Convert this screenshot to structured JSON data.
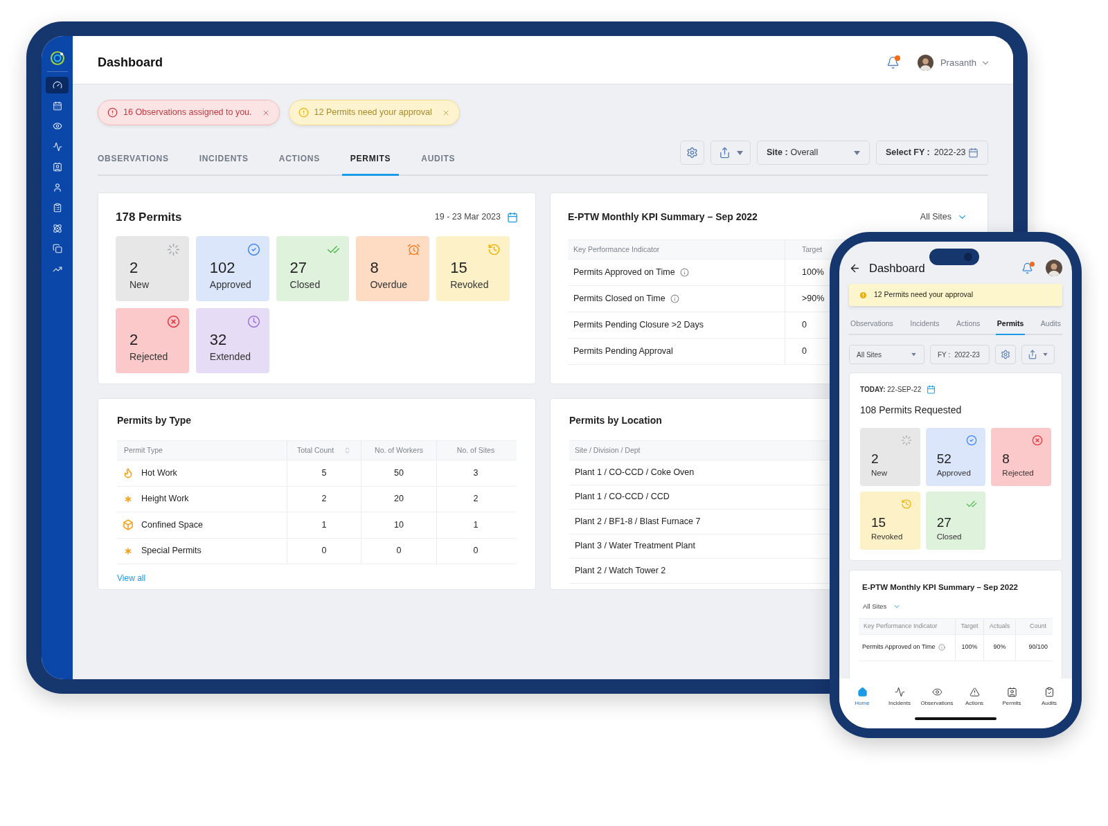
{
  "sidebar": {
    "items": [
      {
        "kind": "gauge",
        "selected": true
      },
      {
        "kind": "calendar",
        "selected": false
      },
      {
        "kind": "eye",
        "selected": false
      },
      {
        "kind": "activity",
        "selected": false
      },
      {
        "kind": "card",
        "selected": false
      },
      {
        "kind": "user",
        "selected": false
      },
      {
        "kind": "clipboard",
        "selected": false
      },
      {
        "kind": "atom",
        "selected": false
      },
      {
        "kind": "copy",
        "selected": false
      },
      {
        "kind": "trend",
        "selected": false
      }
    ]
  },
  "header": {
    "title": "Dashboard",
    "user": "Prasanth",
    "has_unread": true
  },
  "alerts": [
    {
      "kind": "error",
      "text": "16 Observations assigned to you."
    },
    {
      "kind": "warning",
      "text": "12 Permits need your approval"
    }
  ],
  "tabs": [
    {
      "label": "OBSERVATIONS",
      "selected": false
    },
    {
      "label": "INCIDENTS",
      "selected": false
    },
    {
      "label": "ACTIONS",
      "selected": false
    },
    {
      "label": "PERMITS",
      "selected": true
    },
    {
      "label": "AUDITS",
      "selected": false
    }
  ],
  "toolbar": {
    "site": {
      "label": "Site :",
      "value": "Overall"
    },
    "fy": {
      "label": "Select FY :",
      "value": "2022-23"
    }
  },
  "summary": {
    "title": "178 Permits",
    "date_range": "19 - 23 Mar 2023",
    "tiles": [
      {
        "kind": "new",
        "count": "2",
        "label": "New"
      },
      {
        "kind": "approved",
        "count": "102",
        "label": "Approved"
      },
      {
        "kind": "closed",
        "count": "27",
        "label": "Closed"
      },
      {
        "kind": "overdue",
        "count": "8",
        "label": "Overdue"
      },
      {
        "kind": "revoked",
        "count": "15",
        "label": "Revoked"
      },
      {
        "kind": "rejected",
        "count": "2",
        "label": "Rejected"
      },
      {
        "kind": "extended",
        "count": "32",
        "label": "Extended"
      }
    ]
  },
  "kpi": {
    "title": "E-PTW Monthly KPI Summary – Sep 2022",
    "filter": "All Sites",
    "columns": [
      "Key Performance Indicator",
      "Target"
    ],
    "rows": [
      {
        "name": "Permits Approved on Time",
        "info": true,
        "target": "100%"
      },
      {
        "name": "Permits Closed on Time",
        "info": true,
        "target": ">90%"
      },
      {
        "name": "Permits Pending Closure >2 Days",
        "info": false,
        "target": "0"
      },
      {
        "name": "Permits Pending Approval",
        "info": false,
        "target": "0"
      }
    ]
  },
  "by_type": {
    "title": "Permits by Type",
    "columns": [
      "Permit Type",
      "Total Count",
      "No. of Workers",
      "No. of Sites"
    ],
    "rows": [
      {
        "kind": "fire",
        "type": "Hot Work",
        "total": "5",
        "workers": "50",
        "sites": "3"
      },
      {
        "kind": "asterisk",
        "type": "Height Work",
        "total": "2",
        "workers": "20",
        "sites": "2"
      },
      {
        "kind": "space",
        "type": "Confined Space",
        "total": "1",
        "workers": "10",
        "sites": "1"
      },
      {
        "kind": "asterisk",
        "type": "Special Permits",
        "total": "0",
        "workers": "0",
        "sites": "0"
      }
    ],
    "link": "View all"
  },
  "by_location": {
    "title": "Permits by Location",
    "columns": [
      "Site / Division / Dept"
    ],
    "rows": [
      "Plant 1 / CO-CCD / Coke Oven",
      "Plant 1 / CO-CCD / CCD",
      "Plant 2 / BF1-8 / Blast Furnace 7",
      "Plant 3 / Water Treatment Plant",
      "Plant 2 / Watch Tower 2"
    ]
  },
  "phone": {
    "title": "Dashboard",
    "has_unread": true,
    "alert": "12 Permits need your approval",
    "tabs": [
      {
        "label": "Observations",
        "selected": false
      },
      {
        "label": "Incidents",
        "selected": false
      },
      {
        "label": "Actions",
        "selected": false
      },
      {
        "label": "Permits",
        "selected": true
      },
      {
        "label": "Audits",
        "selected": false
      }
    ],
    "site_filter": "All Sites",
    "fy": {
      "label": "FY :",
      "value": "2022-23"
    },
    "today": {
      "label": "TODAY:",
      "value": "22-SEP-22"
    },
    "summary_title": "108 Permits Requested",
    "tiles": [
      {
        "kind": "new",
        "count": "2",
        "label": "New"
      },
      {
        "kind": "approved",
        "count": "52",
        "label": "Approved"
      },
      {
        "kind": "rejected",
        "count": "8",
        "label": "Rejected"
      },
      {
        "kind": "revoked",
        "count": "15",
        "label": "Revoked"
      },
      {
        "kind": "closed",
        "count": "27",
        "label": "Closed"
      }
    ],
    "kpi": {
      "title": "E-PTW Monthly KPI Summary – Sep 2022",
      "filter": "All Sites",
      "columns": [
        "Key Performance Indicator",
        "Target",
        "Actuals",
        "Count"
      ],
      "rows": [
        {
          "name": "Permits Approved on Time",
          "info": true,
          "target": "100%",
          "actuals": "90%",
          "count": "90/100"
        }
      ]
    },
    "nav": [
      {
        "kind": "home",
        "label": "Home",
        "selected": true
      },
      {
        "kind": "incidents",
        "label": "Incidents",
        "selected": false
      },
      {
        "kind": "observations",
        "label": "Observations",
        "selected": false
      },
      {
        "kind": "actions",
        "label": "Actions",
        "selected": false
      },
      {
        "kind": "permits",
        "label": "Permits",
        "selected": false
      },
      {
        "kind": "audits",
        "label": "Audits",
        "selected": false
      }
    ]
  }
}
